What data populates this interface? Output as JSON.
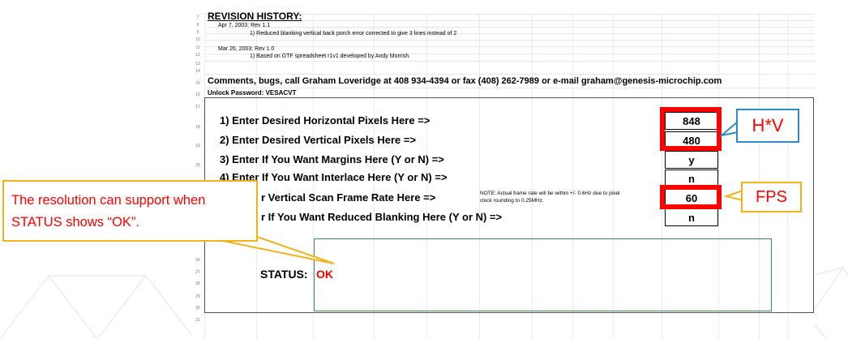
{
  "revision": {
    "heading": "REVISION HISTORY:",
    "entries": [
      "Apr 7, 2003: Rev 1.1",
      "1)   Reduced blanking vertical back porch error corrected to give 3 lines instead of 2",
      "Mar 26, 2003: Rev 1.0",
      "1)   Based on GTF spreadsheet r1v1 developed by Andy Morrish."
    ]
  },
  "comments": "Comments, bugs, call Graham Loveridge at 408 934-4394 or fax (408) 262-7989 or e-mail graham@genesis-microchip.com",
  "unlock": "Unlock Password: VESACVT",
  "rows": {
    "r1": {
      "label": "1) Enter Desired Horizontal Pixels Here =>",
      "value": "848"
    },
    "r2": {
      "label": "2) Enter Desired Vertical Pixels Here =>",
      "value": "480"
    },
    "r3": {
      "label": "3) Enter If You Want Margins Here (Y or N) =>",
      "value": "y"
    },
    "r4": {
      "label": "4) Enter If You Want Interlace Here (Y or N) =>",
      "value": "n"
    },
    "r5": {
      "label": "r Vertical Scan Frame Rate Here =>",
      "value": "60"
    },
    "r6": {
      "label": "r If You Want Reduced Blanking Here (Y or N) =>",
      "value": "n"
    }
  },
  "note": [
    "NOTE: Actual frame rate will be within +/- 0.6Hz due to pixel",
    "clock rounding to 0.25MHz."
  ],
  "status": {
    "label": "STATUS:",
    "value": "OK"
  },
  "row_numbers": [
    "7",
    "8",
    "9",
    "10",
    "11",
    "12",
    "13",
    "14",
    "15",
    "16",
    "17",
    "18",
    "19",
    "20",
    "26",
    "27",
    "28",
    "29",
    "30",
    "31"
  ],
  "annotations": {
    "hv": "H*V",
    "fps": "FPS",
    "status_note_line1": "The resolution can support when",
    "status_note_line2": "STATUS shows “OK”."
  },
  "colors": {
    "red": "#ff0000",
    "blue_callout": "#2e8bc9",
    "orange_callout": "#f2b21c",
    "ok_red": "#ff0000"
  }
}
